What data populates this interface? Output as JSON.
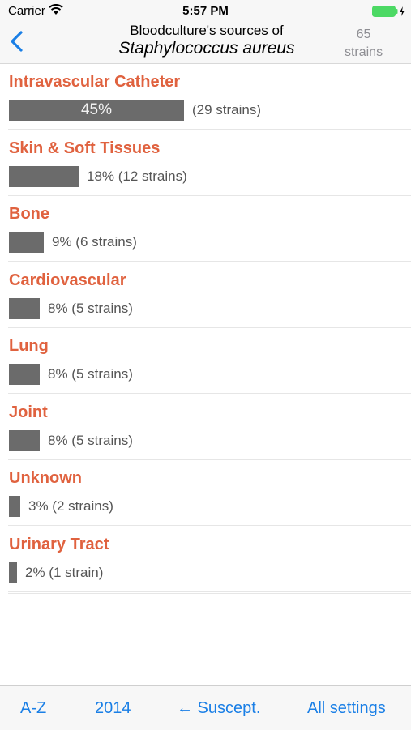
{
  "status_bar": {
    "carrier": "Carrier",
    "time": "5:57 PM",
    "wifi_icon": "wifi-icon",
    "battery_icon": "battery-charging-icon",
    "battery_color": "#4cd964"
  },
  "nav": {
    "back_icon": "chevron-left-icon",
    "title_line1": "Bloodculture's sources of",
    "title_line2": "Staphylococcus aureus",
    "count_number": "65",
    "count_unit": "strains",
    "accent_color": "#1a7fe6"
  },
  "sources": [
    {
      "label": "Intravascular Catheter",
      "percent": 45,
      "bar_text": "45%",
      "side_text": "(29 strains)"
    },
    {
      "label": "Skin & Soft Tissues",
      "percent": 18,
      "bar_text": "",
      "side_text": "18% (12 strains)"
    },
    {
      "label": "Bone",
      "percent": 9,
      "bar_text": "",
      "side_text": "9% (6 strains)"
    },
    {
      "label": "Cardiovascular",
      "percent": 8,
      "bar_text": "",
      "side_text": "8% (5 strains)"
    },
    {
      "label": "Lung",
      "percent": 8,
      "bar_text": "",
      "side_text": "8% (5 strains)"
    },
    {
      "label": "Joint",
      "percent": 8,
      "bar_text": "",
      "side_text": "8% (5 strains)"
    },
    {
      "label": "Unknown",
      "percent": 3,
      "bar_text": "",
      "side_text": "3% (2 strains)"
    },
    {
      "label": "Urinary Tract",
      "percent": 2,
      "bar_text": "",
      "side_text": "2% (1 strain)"
    }
  ],
  "label_color": "#e0623f",
  "bar_color": "#6b6b6b",
  "toolbar": {
    "az_label": "A-Z",
    "year_label": "2014",
    "suscept_label": "← Suscept.",
    "settings_label": "All settings"
  }
}
